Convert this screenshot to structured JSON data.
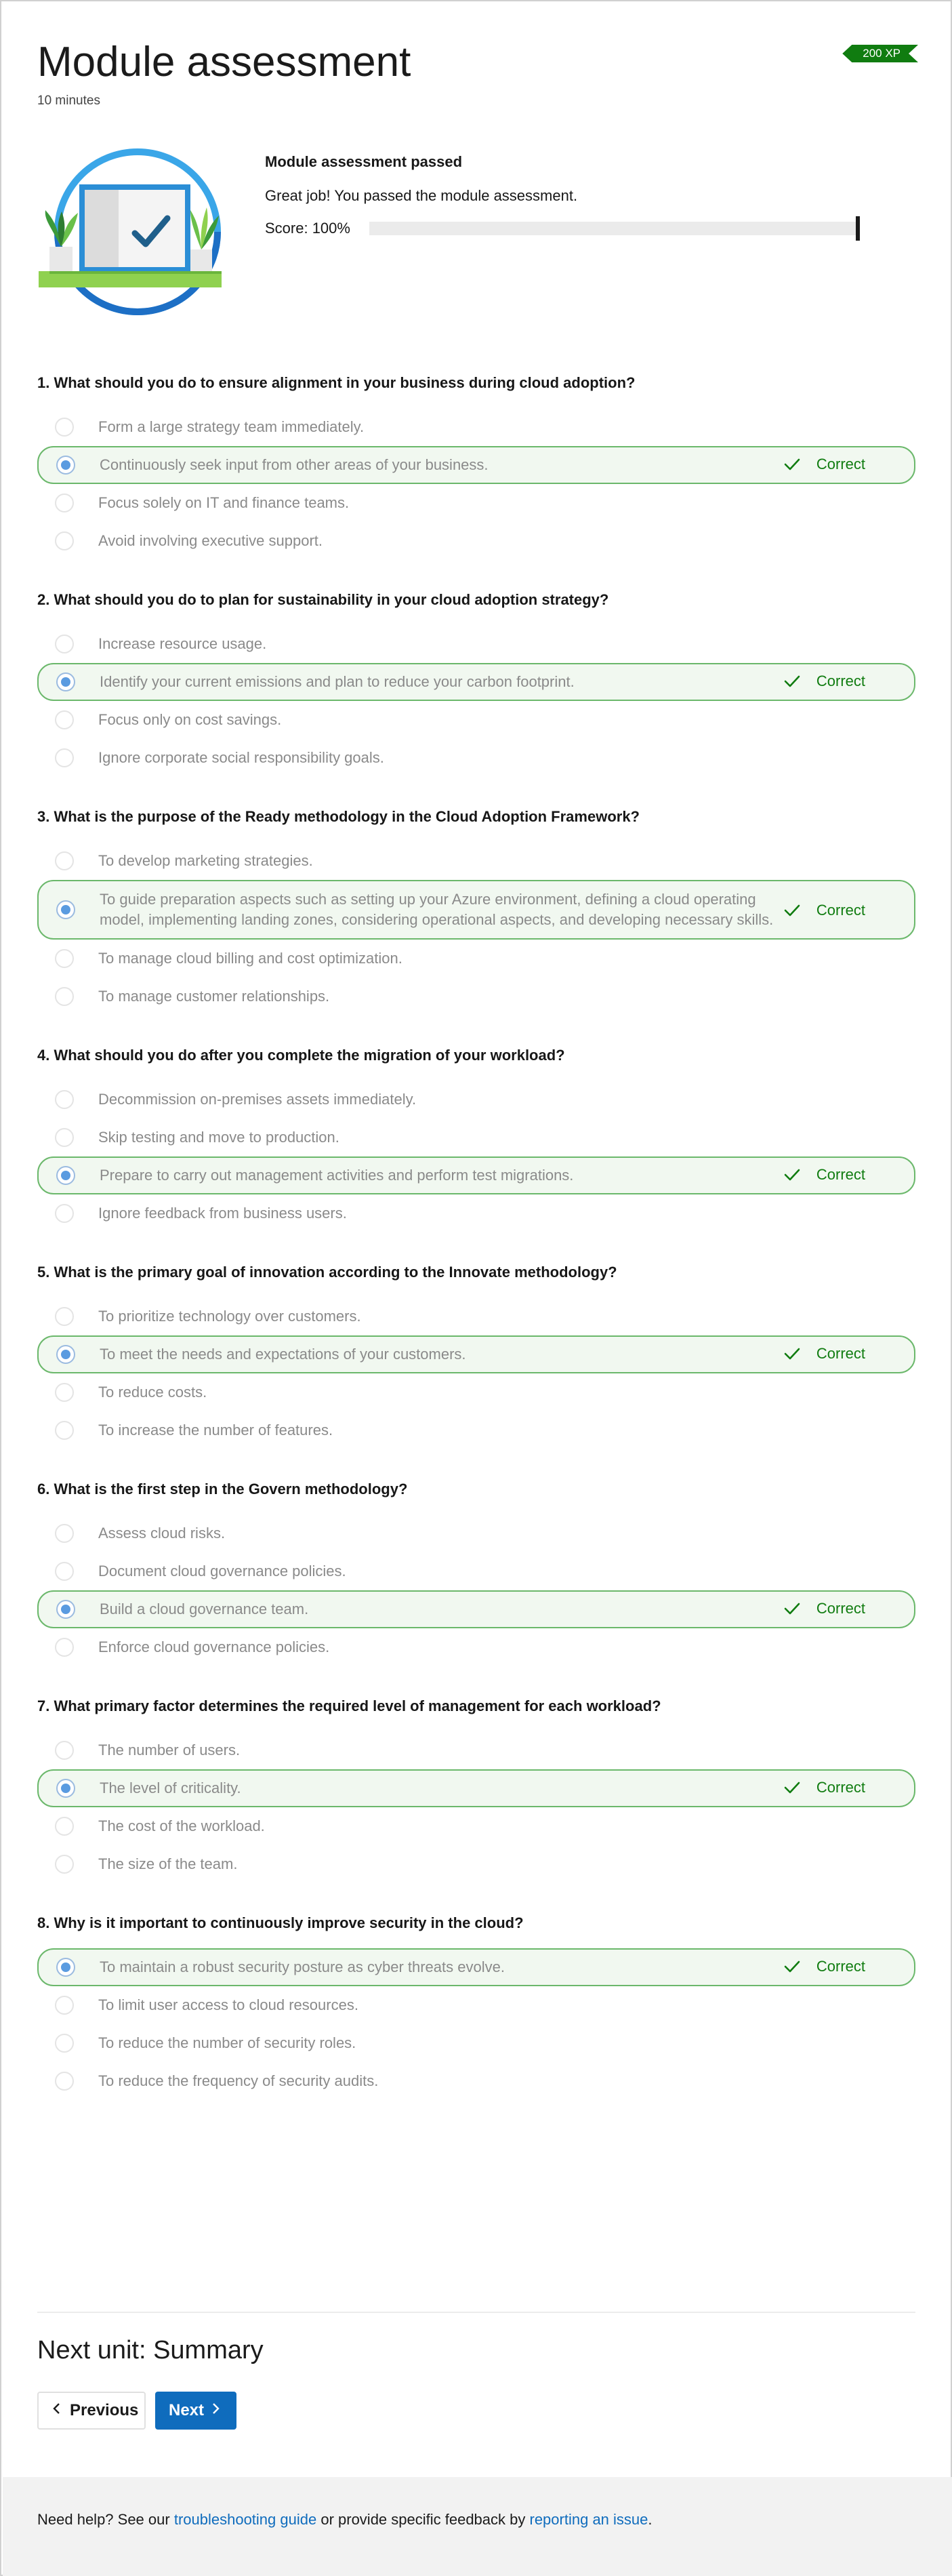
{
  "header": {
    "title": "Module assessment",
    "duration": "10 minutes",
    "xp_badge": "200 XP"
  },
  "result": {
    "title": "Module assessment passed",
    "message": "Great job! You passed the module assessment.",
    "score_label": "Score: 100%",
    "score_fraction": 1.0
  },
  "correct_label": "Correct",
  "questions": [
    {
      "text": "1. What should you do to ensure alignment in your business during cloud adoption?",
      "options": [
        "Form a large strategy team immediately.",
        "Continuously seek input from other areas of your business.",
        "Focus solely on IT and finance teams.",
        "Avoid involving executive support."
      ],
      "correct_index": 1
    },
    {
      "text": "2. What should you do to plan for sustainability in your cloud adoption strategy?",
      "options": [
        "Increase resource usage.",
        "Identify your current emissions and plan to reduce your carbon footprint.",
        "Focus only on cost savings.",
        "Ignore corporate social responsibility goals."
      ],
      "correct_index": 1
    },
    {
      "text": "3. What is the purpose of the Ready methodology in the Cloud Adoption Framework?",
      "options": [
        "To develop marketing strategies.",
        "To guide preparation aspects such as setting up your Azure environment, defining a cloud operating model, implementing landing zones, considering operational aspects, and developing necessary skills.",
        "To manage cloud billing and cost optimization.",
        "To manage customer relationships."
      ],
      "correct_index": 1
    },
    {
      "text": "4. What should you do after you complete the migration of your workload?",
      "options": [
        "Decommission on-premises assets immediately.",
        "Skip testing and move to production.",
        "Prepare to carry out management activities and perform test migrations.",
        "Ignore feedback from business users."
      ],
      "correct_index": 2
    },
    {
      "text": "5. What is the primary goal of innovation according to the Innovate methodology?",
      "options": [
        "To prioritize technology over customers.",
        "To meet the needs and expectations of your customers.",
        "To reduce costs.",
        "To increase the number of features."
      ],
      "correct_index": 1
    },
    {
      "text": "6. What is the first step in the Govern methodology?",
      "options": [
        "Assess cloud risks.",
        "Document cloud governance policies.",
        "Build a cloud governance team.",
        "Enforce cloud governance policies."
      ],
      "correct_index": 2
    },
    {
      "text": "7. What primary factor determines the required level of management for each workload?",
      "options": [
        "The number of users.",
        "The level of criticality.",
        "The cost of the workload.",
        "The size of the team."
      ],
      "correct_index": 1
    },
    {
      "text": "8. Why is it important to continuously improve security in the cloud?",
      "options": [
        "To maintain a robust security posture as cyber threats evolve.",
        "To limit user access to cloud resources.",
        "To reduce the number of security roles.",
        "To reduce the frequency of security audits."
      ],
      "correct_index": 0
    }
  ],
  "next_unit": {
    "title": "Next unit: Summary",
    "previous_label": "Previous",
    "next_label": "Next"
  },
  "footer": {
    "prefix": "Need help? See our ",
    "link1": "troubleshooting guide",
    "middle": " or provide specific feedback by ",
    "link2": "reporting an issue",
    "suffix": "."
  },
  "colors": {
    "accent": "#0f6cbd",
    "success": "#107c10",
    "correct_bg": "#f1f8f0",
    "correct_border": "#6bb86b"
  }
}
